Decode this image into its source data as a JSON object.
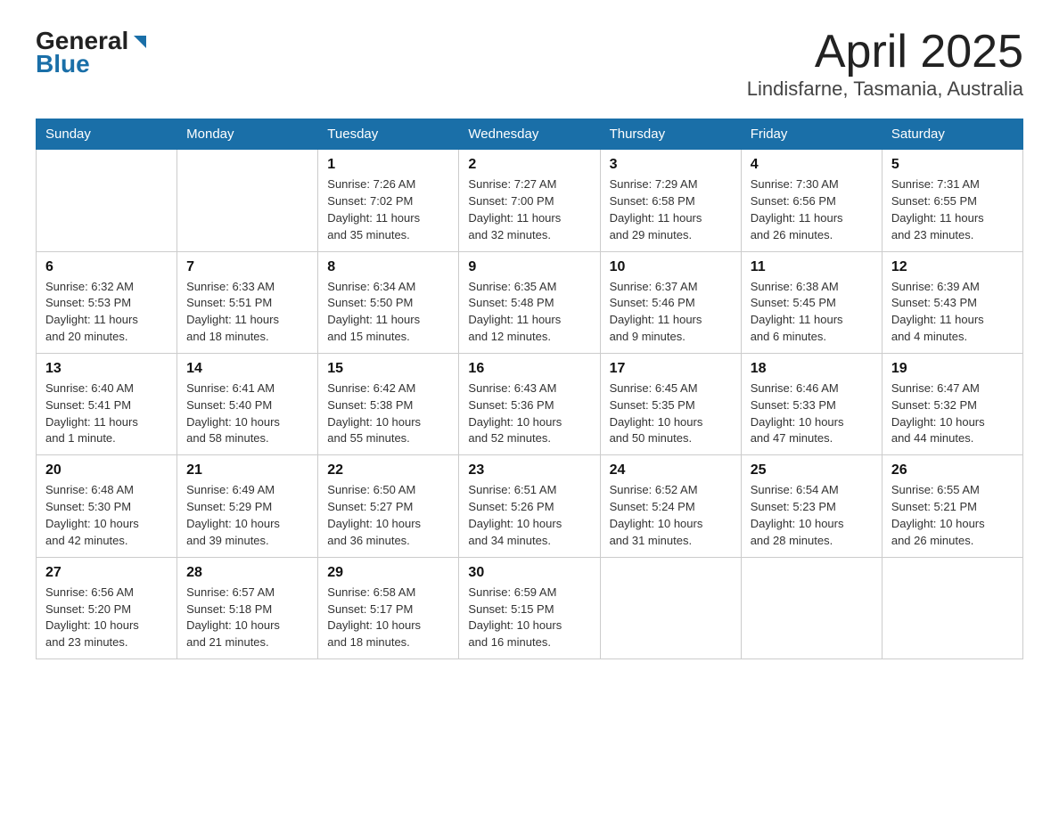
{
  "logo": {
    "general": "General",
    "blue": "Blue"
  },
  "title": "April 2025",
  "subtitle": "Lindisfarne, Tasmania, Australia",
  "weekdays": [
    "Sunday",
    "Monday",
    "Tuesday",
    "Wednesday",
    "Thursday",
    "Friday",
    "Saturday"
  ],
  "weeks": [
    [
      {
        "day": "",
        "info": ""
      },
      {
        "day": "",
        "info": ""
      },
      {
        "day": "1",
        "info": "Sunrise: 7:26 AM\nSunset: 7:02 PM\nDaylight: 11 hours\nand 35 minutes."
      },
      {
        "day": "2",
        "info": "Sunrise: 7:27 AM\nSunset: 7:00 PM\nDaylight: 11 hours\nand 32 minutes."
      },
      {
        "day": "3",
        "info": "Sunrise: 7:29 AM\nSunset: 6:58 PM\nDaylight: 11 hours\nand 29 minutes."
      },
      {
        "day": "4",
        "info": "Sunrise: 7:30 AM\nSunset: 6:56 PM\nDaylight: 11 hours\nand 26 minutes."
      },
      {
        "day": "5",
        "info": "Sunrise: 7:31 AM\nSunset: 6:55 PM\nDaylight: 11 hours\nand 23 minutes."
      }
    ],
    [
      {
        "day": "6",
        "info": "Sunrise: 6:32 AM\nSunset: 5:53 PM\nDaylight: 11 hours\nand 20 minutes."
      },
      {
        "day": "7",
        "info": "Sunrise: 6:33 AM\nSunset: 5:51 PM\nDaylight: 11 hours\nand 18 minutes."
      },
      {
        "day": "8",
        "info": "Sunrise: 6:34 AM\nSunset: 5:50 PM\nDaylight: 11 hours\nand 15 minutes."
      },
      {
        "day": "9",
        "info": "Sunrise: 6:35 AM\nSunset: 5:48 PM\nDaylight: 11 hours\nand 12 minutes."
      },
      {
        "day": "10",
        "info": "Sunrise: 6:37 AM\nSunset: 5:46 PM\nDaylight: 11 hours\nand 9 minutes."
      },
      {
        "day": "11",
        "info": "Sunrise: 6:38 AM\nSunset: 5:45 PM\nDaylight: 11 hours\nand 6 minutes."
      },
      {
        "day": "12",
        "info": "Sunrise: 6:39 AM\nSunset: 5:43 PM\nDaylight: 11 hours\nand 4 minutes."
      }
    ],
    [
      {
        "day": "13",
        "info": "Sunrise: 6:40 AM\nSunset: 5:41 PM\nDaylight: 11 hours\nand 1 minute."
      },
      {
        "day": "14",
        "info": "Sunrise: 6:41 AM\nSunset: 5:40 PM\nDaylight: 10 hours\nand 58 minutes."
      },
      {
        "day": "15",
        "info": "Sunrise: 6:42 AM\nSunset: 5:38 PM\nDaylight: 10 hours\nand 55 minutes."
      },
      {
        "day": "16",
        "info": "Sunrise: 6:43 AM\nSunset: 5:36 PM\nDaylight: 10 hours\nand 52 minutes."
      },
      {
        "day": "17",
        "info": "Sunrise: 6:45 AM\nSunset: 5:35 PM\nDaylight: 10 hours\nand 50 minutes."
      },
      {
        "day": "18",
        "info": "Sunrise: 6:46 AM\nSunset: 5:33 PM\nDaylight: 10 hours\nand 47 minutes."
      },
      {
        "day": "19",
        "info": "Sunrise: 6:47 AM\nSunset: 5:32 PM\nDaylight: 10 hours\nand 44 minutes."
      }
    ],
    [
      {
        "day": "20",
        "info": "Sunrise: 6:48 AM\nSunset: 5:30 PM\nDaylight: 10 hours\nand 42 minutes."
      },
      {
        "day": "21",
        "info": "Sunrise: 6:49 AM\nSunset: 5:29 PM\nDaylight: 10 hours\nand 39 minutes."
      },
      {
        "day": "22",
        "info": "Sunrise: 6:50 AM\nSunset: 5:27 PM\nDaylight: 10 hours\nand 36 minutes."
      },
      {
        "day": "23",
        "info": "Sunrise: 6:51 AM\nSunset: 5:26 PM\nDaylight: 10 hours\nand 34 minutes."
      },
      {
        "day": "24",
        "info": "Sunrise: 6:52 AM\nSunset: 5:24 PM\nDaylight: 10 hours\nand 31 minutes."
      },
      {
        "day": "25",
        "info": "Sunrise: 6:54 AM\nSunset: 5:23 PM\nDaylight: 10 hours\nand 28 minutes."
      },
      {
        "day": "26",
        "info": "Sunrise: 6:55 AM\nSunset: 5:21 PM\nDaylight: 10 hours\nand 26 minutes."
      }
    ],
    [
      {
        "day": "27",
        "info": "Sunrise: 6:56 AM\nSunset: 5:20 PM\nDaylight: 10 hours\nand 23 minutes."
      },
      {
        "day": "28",
        "info": "Sunrise: 6:57 AM\nSunset: 5:18 PM\nDaylight: 10 hours\nand 21 minutes."
      },
      {
        "day": "29",
        "info": "Sunrise: 6:58 AM\nSunset: 5:17 PM\nDaylight: 10 hours\nand 18 minutes."
      },
      {
        "day": "30",
        "info": "Sunrise: 6:59 AM\nSunset: 5:15 PM\nDaylight: 10 hours\nand 16 minutes."
      },
      {
        "day": "",
        "info": ""
      },
      {
        "day": "",
        "info": ""
      },
      {
        "day": "",
        "info": ""
      }
    ]
  ]
}
